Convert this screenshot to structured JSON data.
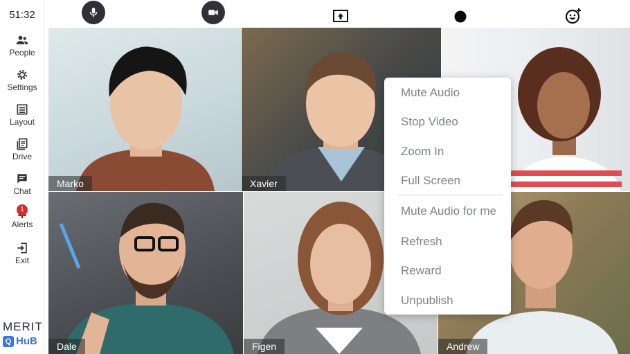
{
  "timer": "51:32",
  "sidebar": {
    "items": [
      {
        "label": "People",
        "icon": "people-icon"
      },
      {
        "label": "Settings",
        "icon": "gear-icon"
      },
      {
        "label": "Layout",
        "icon": "layout-icon"
      },
      {
        "label": "Drive",
        "icon": "drive-icon"
      },
      {
        "label": "Chat",
        "icon": "chat-icon"
      },
      {
        "label": "Alerts",
        "icon": "bell-icon",
        "badge": "1"
      },
      {
        "label": "Exit",
        "icon": "exit-icon"
      }
    ]
  },
  "brand": {
    "top": "MERIT",
    "bottom": "HuB",
    "mark": "Q"
  },
  "toolbar": {
    "buttons": [
      "microphone-icon",
      "video-camera-icon",
      "screen-share-icon",
      "record-icon",
      "emoji-reaction-icon"
    ]
  },
  "participants": [
    {
      "name": "Marko"
    },
    {
      "name": "Xavier"
    },
    {
      "name": ""
    },
    {
      "name": "Dale"
    },
    {
      "name": "Figen"
    },
    {
      "name": "Andrew"
    }
  ],
  "context_menu": {
    "items": [
      "Mute Audio",
      "Stop Video",
      "Zoom In",
      "Full Screen",
      "Mute Audio for me",
      "Refresh",
      "Reward",
      "Unpublish"
    ]
  },
  "colors": {
    "accent": "#3b73e8",
    "badge": "#e0262c",
    "toolbar_button": "#2f3136"
  }
}
